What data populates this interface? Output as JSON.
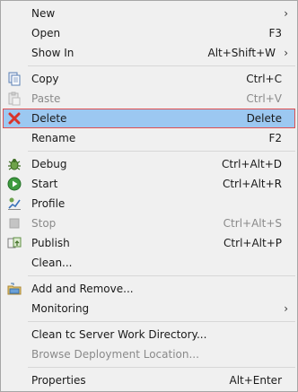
{
  "menu": {
    "new": {
      "label": "New"
    },
    "open": {
      "label": "Open",
      "shortcut": "F3"
    },
    "show_in": {
      "label": "Show In",
      "shortcut": "Alt+Shift+W"
    },
    "copy": {
      "label": "Copy",
      "shortcut": "Ctrl+C",
      "icon": "copy-icon"
    },
    "paste": {
      "label": "Paste",
      "shortcut": "Ctrl+V",
      "icon": "paste-icon",
      "disabled": true
    },
    "delete": {
      "label": "Delete",
      "shortcut": "Delete",
      "icon": "delete-icon",
      "selected": true
    },
    "rename": {
      "label": "Rename",
      "shortcut": "F2"
    },
    "debug": {
      "label": "Debug",
      "shortcut": "Ctrl+Alt+D",
      "icon": "debug-bug-icon"
    },
    "start": {
      "label": "Start",
      "shortcut": "Ctrl+Alt+R",
      "icon": "start-play-icon"
    },
    "profile": {
      "label": "Profile",
      "icon": "profile-icon"
    },
    "stop": {
      "label": "Stop",
      "shortcut": "Ctrl+Alt+S",
      "icon": "stop-icon",
      "disabled": true
    },
    "publish": {
      "label": "Publish",
      "shortcut": "Ctrl+Alt+P",
      "icon": "publish-icon"
    },
    "clean": {
      "label": "Clean..."
    },
    "add_remove": {
      "label": "Add and Remove...",
      "icon": "add-remove-icon"
    },
    "monitoring": {
      "label": "Monitoring"
    },
    "clean_tc": {
      "label": "Clean tc Server Work Directory..."
    },
    "browse_deploy": {
      "label": "Browse Deployment Location...",
      "disabled": true
    },
    "properties": {
      "label": "Properties",
      "shortcut": "Alt+Enter"
    }
  },
  "colors": {
    "selection_bg": "#9cc8f1",
    "selection_border": "#e04f4f",
    "disabled_text": "#8a8a8a"
  }
}
